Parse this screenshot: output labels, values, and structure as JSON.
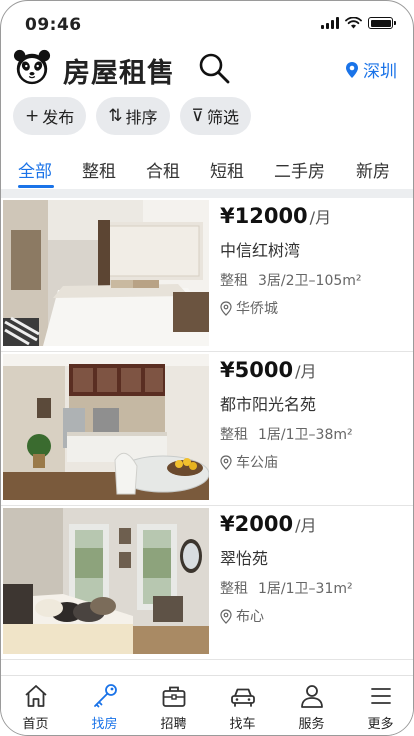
{
  "status_bar": {
    "time": "09:46"
  },
  "header": {
    "title": "房屋租售",
    "city": "深圳"
  },
  "chips": [
    {
      "glyph": "+",
      "label": "发布"
    },
    {
      "glyph": "⇅",
      "label": "排序"
    },
    {
      "glyph": "⊽",
      "label": "筛选"
    }
  ],
  "tabs": [
    "全部",
    "整租",
    "合租",
    "短租",
    "二手房",
    "新房"
  ],
  "active_tab": "全部",
  "listings": [
    {
      "price": "¥12000",
      "unit": "/月",
      "name": "中信红树湾",
      "type": "整租",
      "layout": "3居/2卫–105m²",
      "location": "华侨城"
    },
    {
      "price": "¥5000",
      "unit": "/月",
      "name": "都市阳光名苑",
      "type": "整租",
      "layout": "1居/1卫–38m²",
      "location": "车公庙"
    },
    {
      "price": "¥2000",
      "unit": "/月",
      "name": "翠怡苑",
      "type": "整租",
      "layout": "1居/1卫–31m²",
      "location": "布心"
    }
  ],
  "bottom_nav": [
    {
      "label": "首页",
      "icon": "home-icon"
    },
    {
      "label": "找房",
      "icon": "key-icon"
    },
    {
      "label": "招聘",
      "icon": "briefcase-icon"
    },
    {
      "label": "找车",
      "icon": "car-icon"
    },
    {
      "label": "服务",
      "icon": "person-icon"
    },
    {
      "label": "更多",
      "icon": "menu-icon"
    }
  ],
  "active_nav": "找房",
  "colors": {
    "accent": "#1a73e8",
    "chip_bg": "#e8eaed",
    "divider": "#eceef0"
  }
}
